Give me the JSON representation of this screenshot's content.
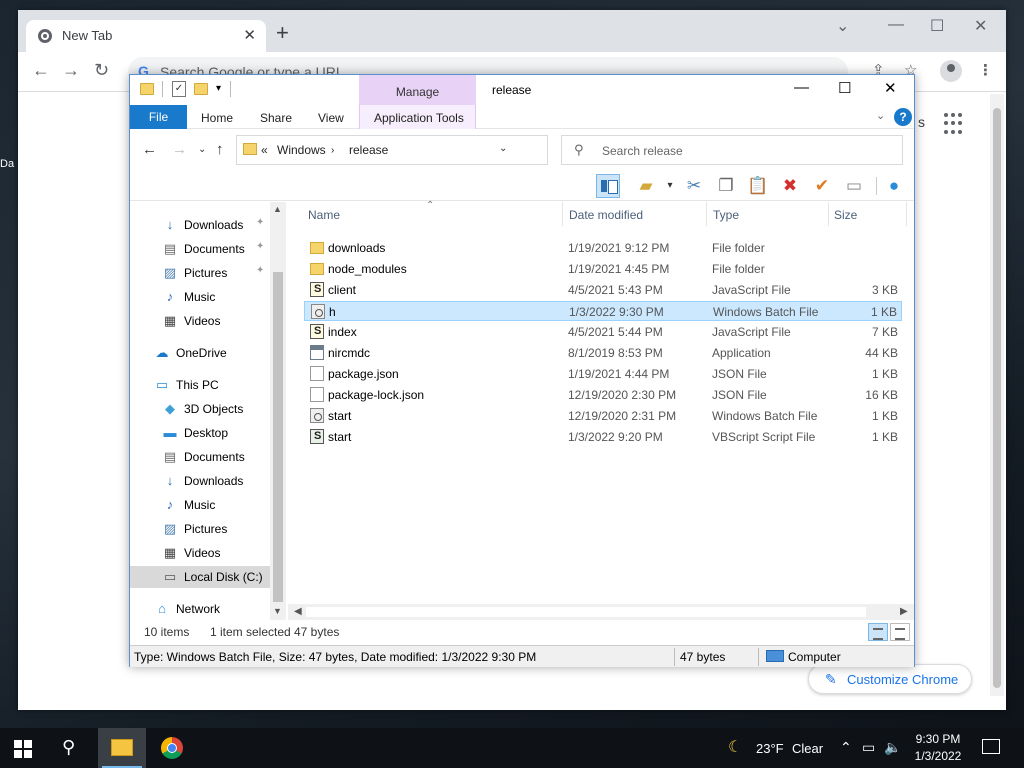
{
  "desktop": {
    "frag1": "Da"
  },
  "chrome": {
    "tab_title": "New Tab",
    "omnibox_placeholder": "Search Google or type a URL",
    "partial_text": "s",
    "customize_label": "Customize Chrome"
  },
  "explorer": {
    "title": "release",
    "manage_tab": "Manage",
    "ribbon_tabs": [
      "File",
      "Home",
      "Share",
      "View",
      "Application Tools"
    ],
    "address": {
      "prefix": "«",
      "crumbs": [
        "Windows",
        "release"
      ]
    },
    "search_placeholder": "Search release",
    "nav_items": [
      {
        "label": "Downloads",
        "icon": "download-arrow-icon",
        "pinned": true
      },
      {
        "label": "Documents",
        "icon": "documents-icon",
        "pinned": true
      },
      {
        "label": "Pictures",
        "icon": "pictures-icon",
        "pinned": true
      },
      {
        "label": "Music",
        "icon": "music-note-icon",
        "pinned": false
      },
      {
        "label": "Videos",
        "icon": "videos-icon",
        "pinned": false
      },
      {
        "label": "OneDrive",
        "icon": "cloud-icon",
        "pinned": false
      },
      {
        "label": "This PC",
        "icon": "computer-icon",
        "pinned": false
      },
      {
        "label": "3D Objects",
        "icon": "cube-icon",
        "pinned": false
      },
      {
        "label": "Desktop",
        "icon": "desktop-icon",
        "pinned": false
      },
      {
        "label": "Documents",
        "icon": "documents-icon",
        "pinned": false
      },
      {
        "label": "Downloads",
        "icon": "download-arrow-icon",
        "pinned": false
      },
      {
        "label": "Music",
        "icon": "music-note-icon",
        "pinned": false
      },
      {
        "label": "Pictures",
        "icon": "pictures-icon",
        "pinned": false
      },
      {
        "label": "Videos",
        "icon": "videos-icon",
        "pinned": false
      },
      {
        "label": "Local Disk (C:)",
        "icon": "drive-icon",
        "pinned": false
      },
      {
        "label": "Network",
        "icon": "network-icon",
        "pinned": false
      }
    ],
    "columns": [
      "Name",
      "Date modified",
      "Type",
      "Size"
    ],
    "files": [
      {
        "name": "downloads",
        "date": "1/19/2021 9:12 PM",
        "type": "File folder",
        "size": "",
        "icon": "folder"
      },
      {
        "name": "node_modules",
        "date": "1/19/2021 4:45 PM",
        "type": "File folder",
        "size": "",
        "icon": "folder"
      },
      {
        "name": "client",
        "date": "4/5/2021 5:43 PM",
        "type": "JavaScript File",
        "size": "3 KB",
        "icon": "js"
      },
      {
        "name": "h",
        "date": "1/3/2022 9:30 PM",
        "type": "Windows Batch File",
        "size": "1 KB",
        "icon": "bat",
        "selected": true
      },
      {
        "name": "index",
        "date": "4/5/2021 5:44 PM",
        "type": "JavaScript File",
        "size": "7 KB",
        "icon": "js"
      },
      {
        "name": "nircmdc",
        "date": "8/1/2019 8:53 PM",
        "type": "Application",
        "size": "44 KB",
        "icon": "app"
      },
      {
        "name": "package.json",
        "date": "1/19/2021 4:44 PM",
        "type": "JSON File",
        "size": "1 KB",
        "icon": "doc"
      },
      {
        "name": "package-lock.json",
        "date": "12/19/2020 2:30 PM",
        "type": "JSON File",
        "size": "16 KB",
        "icon": "doc"
      },
      {
        "name": "start",
        "date": "12/19/2020 2:31 PM",
        "type": "Windows Batch File",
        "size": "1 KB",
        "icon": "bat"
      },
      {
        "name": "start",
        "date": "1/3/2022 9:20 PM",
        "type": "VBScript Script File",
        "size": "1 KB",
        "icon": "vbs"
      }
    ],
    "status": {
      "count": "10 items",
      "selected": "1 item selected",
      "selected_size": "47 bytes",
      "details": "Type: Windows Batch File, Size: 47 bytes, Date modified: 1/3/2022 9:30 PM",
      "size2": "47 bytes",
      "location": "Computer"
    }
  },
  "taskbar": {
    "weather_temp": "23°F",
    "weather_text": "Clear",
    "time": "9:30 PM",
    "date": "1/3/2022"
  }
}
